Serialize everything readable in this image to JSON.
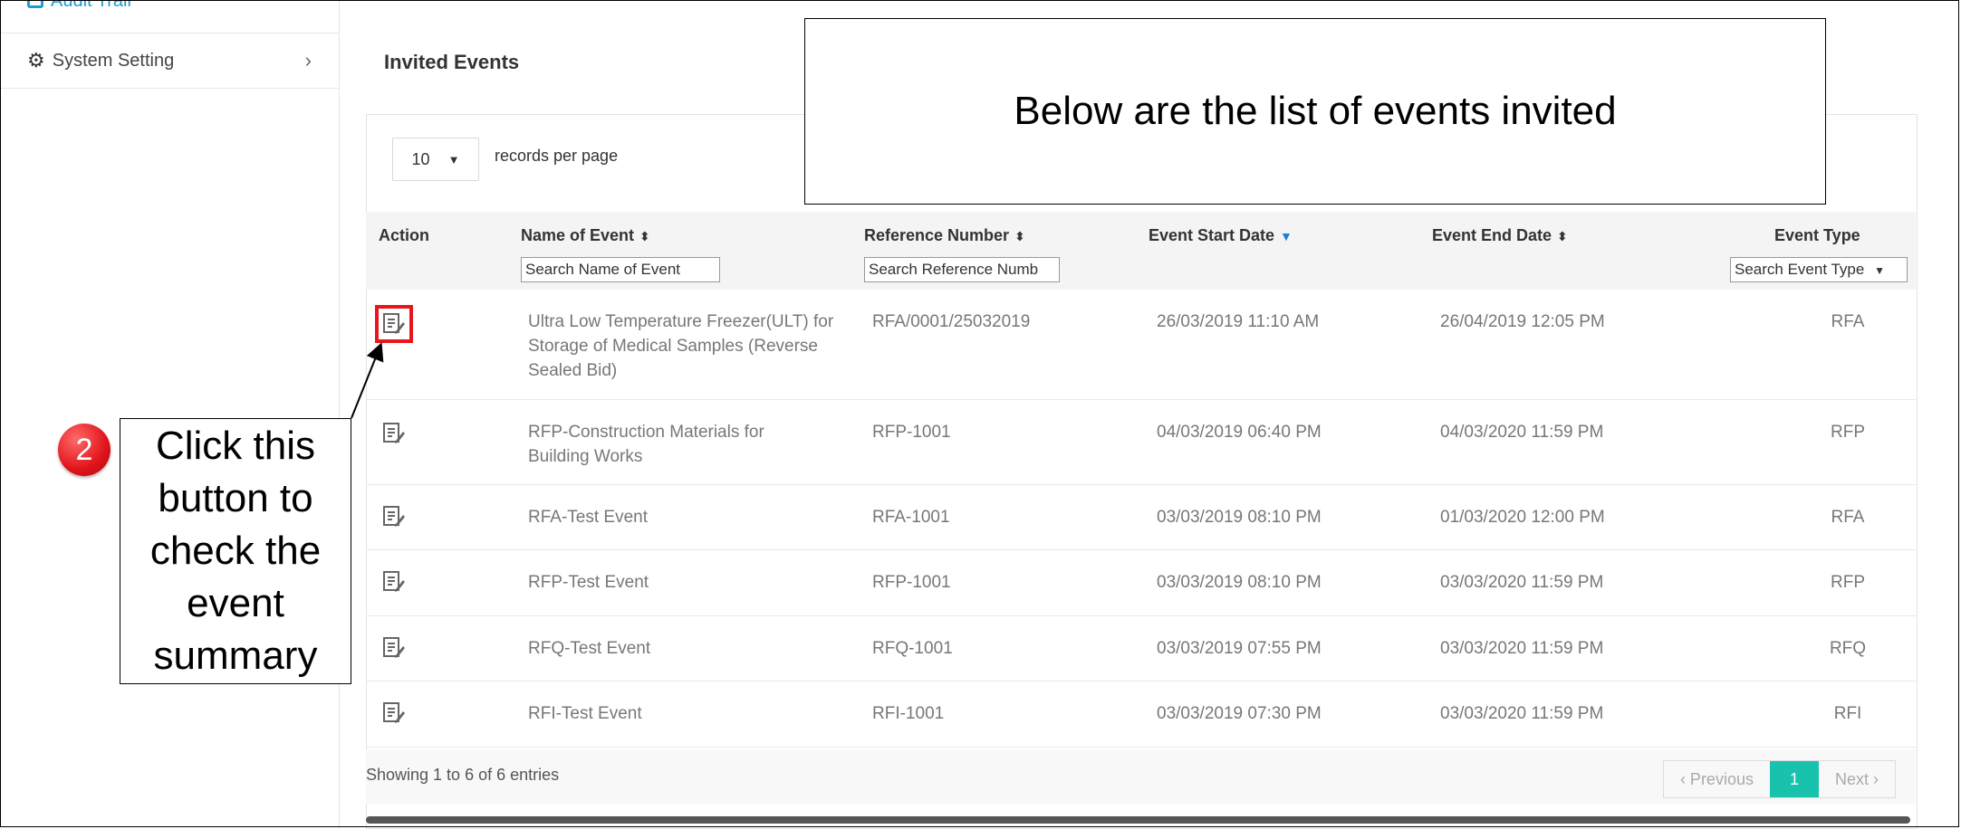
{
  "sidebar": {
    "audit_label": "Audit Trail",
    "system_setting_label": "System Setting"
  },
  "page": {
    "title": "Invited Events",
    "records_per_page_value": "10",
    "records_per_page_label": "records per page"
  },
  "table": {
    "headers": {
      "action": "Action",
      "name": "Name of Event",
      "reference": "Reference Number",
      "start": "Event Start Date",
      "end": "Event End Date",
      "type": "Event Type"
    },
    "filters": {
      "name_placeholder": "Search Name of Event",
      "reference_placeholder": "Search Reference Numb",
      "type_placeholder": "Search Event Type"
    },
    "rows": [
      {
        "name": "Ultra Low Temperature Freezer(ULT) for Storage of Medical Samples (Reverse Sealed Bid)",
        "reference": "RFA/0001/25032019",
        "start": "26/03/2019 11:10 AM",
        "end": "26/04/2019 12:05 PM",
        "type": "RFA"
      },
      {
        "name": "RFP-Construction Materials for Building Works",
        "reference": "RFP-1001",
        "start": "04/03/2019 06:40 PM",
        "end": "04/03/2020 11:59 PM",
        "type": "RFP"
      },
      {
        "name": "RFA-Test Event",
        "reference": "RFA-1001",
        "start": "03/03/2019 08:10 PM",
        "end": "01/03/2020 12:00 PM",
        "type": "RFA"
      },
      {
        "name": "RFP-Test Event",
        "reference": "RFP-1001",
        "start": "03/03/2019 08:10 PM",
        "end": "03/03/2020 11:59 PM",
        "type": "RFP"
      },
      {
        "name": "RFQ-Test Event",
        "reference": "RFQ-1001",
        "start": "03/03/2019 07:55 PM",
        "end": "03/03/2020 11:59 PM",
        "type": "RFQ"
      },
      {
        "name": "RFI-Test Event",
        "reference": "RFI-1001",
        "start": "03/03/2019 07:30 PM",
        "end": "03/03/2020 11:59 PM",
        "type": "RFI"
      }
    ],
    "footer_info": "Showing 1 to 6 of 6 entries"
  },
  "pager": {
    "previous": "‹ Previous",
    "current": "1",
    "next": "Next ›"
  },
  "callouts": {
    "top_text": "Below are the list of events invited",
    "badge_number": "2",
    "left_text": "Click this button to check the event summary"
  },
  "colors": {
    "accent_blue": "#1d9bd7",
    "highlight_red": "#e8161c",
    "pager_active": "#18c2ad"
  },
  "icons": {
    "edit": "edit-document-icon",
    "settings": "gear-icon",
    "chevron": "chevron-right-icon",
    "audit": "audit-trail-icon"
  }
}
